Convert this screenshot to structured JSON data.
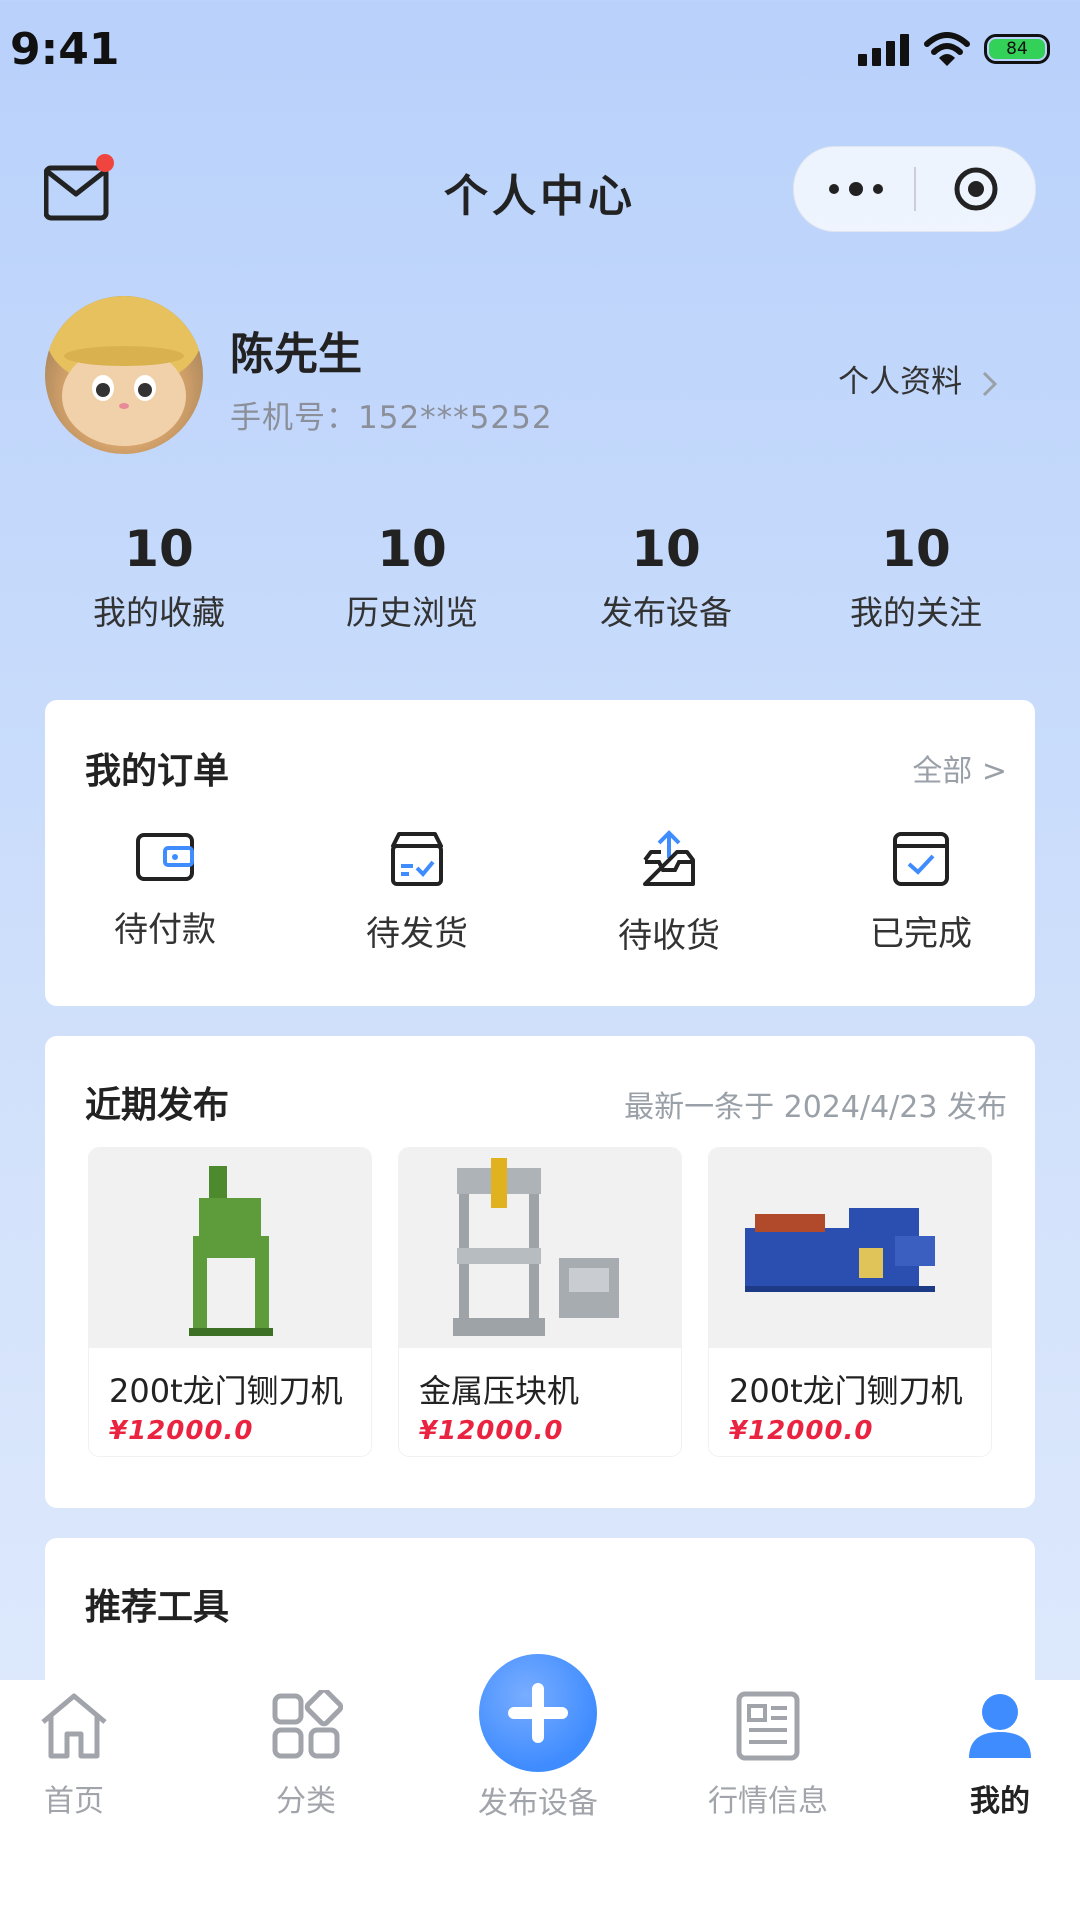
{
  "status_bar": {
    "time": "9:41",
    "battery": "84"
  },
  "header": {
    "title": "个人中心"
  },
  "profile": {
    "name": "陈先生",
    "phone": "手机号：152***5252",
    "link": "个人资料"
  },
  "stats": [
    {
      "value": "10",
      "label": "我的收藏"
    },
    {
      "value": "10",
      "label": "历史浏览"
    },
    {
      "value": "10",
      "label": "发布设备"
    },
    {
      "value": "10",
      "label": "我的关注"
    }
  ],
  "orders": {
    "title": "我的订单",
    "all_link": "全部 >",
    "items": [
      {
        "label": "待付款",
        "icon": "wallet-icon"
      },
      {
        "label": "待发货",
        "icon": "package-icon"
      },
      {
        "label": "待收货",
        "icon": "inbox-upload-icon"
      },
      {
        "label": "已完成",
        "icon": "calendar-check-icon"
      }
    ]
  },
  "recent": {
    "title": "近期发布",
    "subtitle": "最新一条于 2024/4/23 发布",
    "products": [
      {
        "name": "200t龙门铡刀机",
        "price": "¥12000.0"
      },
      {
        "name": "金属压块机",
        "price": "¥12000.0"
      },
      {
        "name": "200t龙门铡刀机",
        "price": "¥12000.0"
      }
    ]
  },
  "tools": {
    "title": "推荐工具"
  },
  "tabbar": [
    {
      "label": "首页",
      "icon": "home-icon"
    },
    {
      "label": "分类",
      "icon": "category-icon"
    },
    {
      "label": "发布设备",
      "icon": "plus-icon"
    },
    {
      "label": "行情信息",
      "icon": "news-icon"
    },
    {
      "label": "我的",
      "icon": "user-icon"
    }
  ],
  "colors": {
    "accent": "#3f8cff",
    "price": "#ea2340",
    "notify_dot": "#f0453f"
  }
}
